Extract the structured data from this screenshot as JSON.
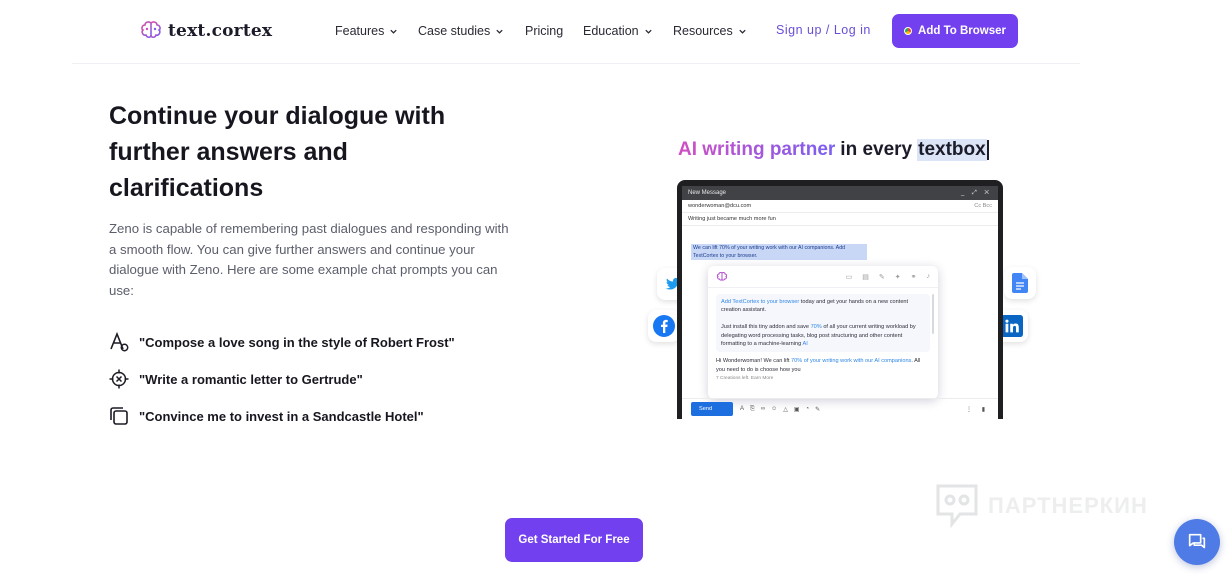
{
  "header": {
    "logo_text": "text.cortex",
    "nav": [
      {
        "label": "Features",
        "has_dropdown": true
      },
      {
        "label": "Case studies",
        "has_dropdown": true
      },
      {
        "label": "Pricing",
        "has_dropdown": false
      },
      {
        "label": "Education",
        "has_dropdown": true
      },
      {
        "label": "Resources",
        "has_dropdown": true
      }
    ],
    "signup_label": "Sign up / Log in",
    "add_browser_label": "Add To Browser"
  },
  "hero": {
    "headline": "Continue your dialogue with further answers and clarifications",
    "description": "Zeno is capable of remembering past dialogues and responding with a smooth flow. You can give further answers and continue your dialogue with Zeno. Here are some example chat prompts you can use:",
    "prompts": [
      {
        "icon": "font-style-icon",
        "text": "\"Compose a love song in the style of Robert Frost\""
      },
      {
        "icon": "target-icon",
        "text": "\"Write a romantic letter to Gertrude\""
      },
      {
        "icon": "copy-icon",
        "text": "\"Convince me to invest in a Sandcastle Hotel\""
      }
    ]
  },
  "illustration": {
    "title_gradient": "AI writing partner",
    "title_mid": "in every",
    "title_highlight": "textbox",
    "window_title": "New Message",
    "to_address": "wonderwoman@dcu.com",
    "cc_label": "Cc Bcc",
    "subject": "Writing just became much more fun",
    "selected_text": "We can lift 70% of your writing work with our AI companions. Add TextCortex to your browser.",
    "assistant_msg_link": "Add TextCortex to your browser",
    "assistant_msg_rest": " today and get your hands on a new content creation assistant.",
    "assistant_msg_body_a": "Just install this tiny addon and save ",
    "assistant_msg_pct": "70%",
    "assistant_msg_body_b": " of all your current writing workload by delegating word processing tasks, blog post structuring and other content formatting to a machine-learning ",
    "assistant_msg_ai": "AI",
    "reply_a": "Hi Wonderwoman! We can lift ",
    "reply_link": "70% of your writing work with our AI companions",
    "reply_b": ". All you need to do is choose how you",
    "creations_left": "7 Creations left. Earn More",
    "send_label": "Send"
  },
  "cta_label": "Get Started For Free",
  "watermark_text": "ПАРТНЕРКИН",
  "colors": {
    "brand_purple": "#7340f0",
    "link_purple": "#6a4ed6",
    "chat_blue": "#4f7be6"
  }
}
